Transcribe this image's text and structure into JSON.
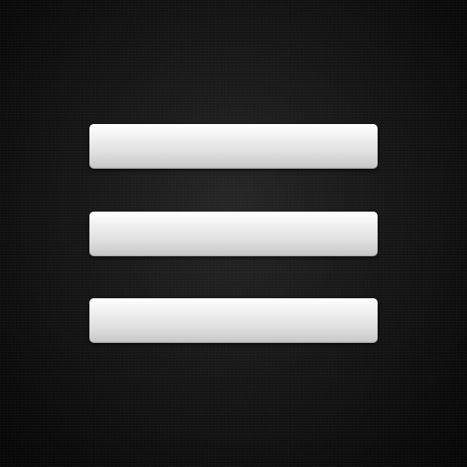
{
  "screen": {
    "background": "#111111",
    "icon": {
      "name": "hamburger-menu-icon",
      "bar_color": "#e6e6e6",
      "bars": [
        {
          "name": "menu-bar-top"
        },
        {
          "name": "menu-bar-middle"
        },
        {
          "name": "menu-bar-bottom"
        }
      ]
    }
  }
}
